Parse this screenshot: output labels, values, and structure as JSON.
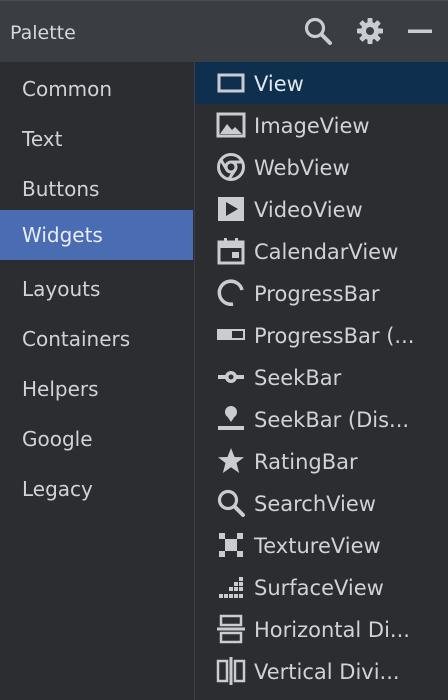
{
  "header": {
    "title": "Palette",
    "icons": [
      "search-icon",
      "gear-icon",
      "minimize-icon"
    ]
  },
  "sidebar": {
    "items": [
      {
        "label": "Common"
      },
      {
        "label": "Text"
      },
      {
        "label": "Buttons"
      },
      {
        "label": "Widgets",
        "selected": true
      },
      {
        "label": "Layouts"
      },
      {
        "label": "Containers"
      },
      {
        "label": "Helpers"
      },
      {
        "label": "Google"
      },
      {
        "label": "Legacy"
      }
    ]
  },
  "widgets": {
    "items": [
      {
        "label": "View",
        "icon": "view-icon",
        "selected": true
      },
      {
        "label": "ImageView",
        "icon": "image-icon"
      },
      {
        "label": "WebView",
        "icon": "web-icon"
      },
      {
        "label": "VideoView",
        "icon": "video-icon"
      },
      {
        "label": "CalendarView",
        "icon": "calendar-icon"
      },
      {
        "label": "ProgressBar",
        "icon": "progress-circle-icon"
      },
      {
        "label": "ProgressBar (...",
        "icon": "progress-horizontal-icon"
      },
      {
        "label": "SeekBar",
        "icon": "seekbar-icon"
      },
      {
        "label": "SeekBar (Dis...",
        "icon": "seekbar-discrete-icon"
      },
      {
        "label": "RatingBar",
        "icon": "star-icon"
      },
      {
        "label": "SearchView",
        "icon": "search-icon"
      },
      {
        "label": "TextureView",
        "icon": "texture-icon"
      },
      {
        "label": "SurfaceView",
        "icon": "surface-icon"
      },
      {
        "label": "Horizontal Di...",
        "icon": "horizontal-divider-icon"
      },
      {
        "label": "Vertical Divi...",
        "icon": "vertical-divider-icon"
      }
    ]
  },
  "colors": {
    "header_bg": "#3a3d41",
    "panel_bg": "#2b2d30",
    "sidebar_selected": "#4a6cb3",
    "list_selected": "#0e2f4d",
    "icon": "#c9ccd1"
  }
}
